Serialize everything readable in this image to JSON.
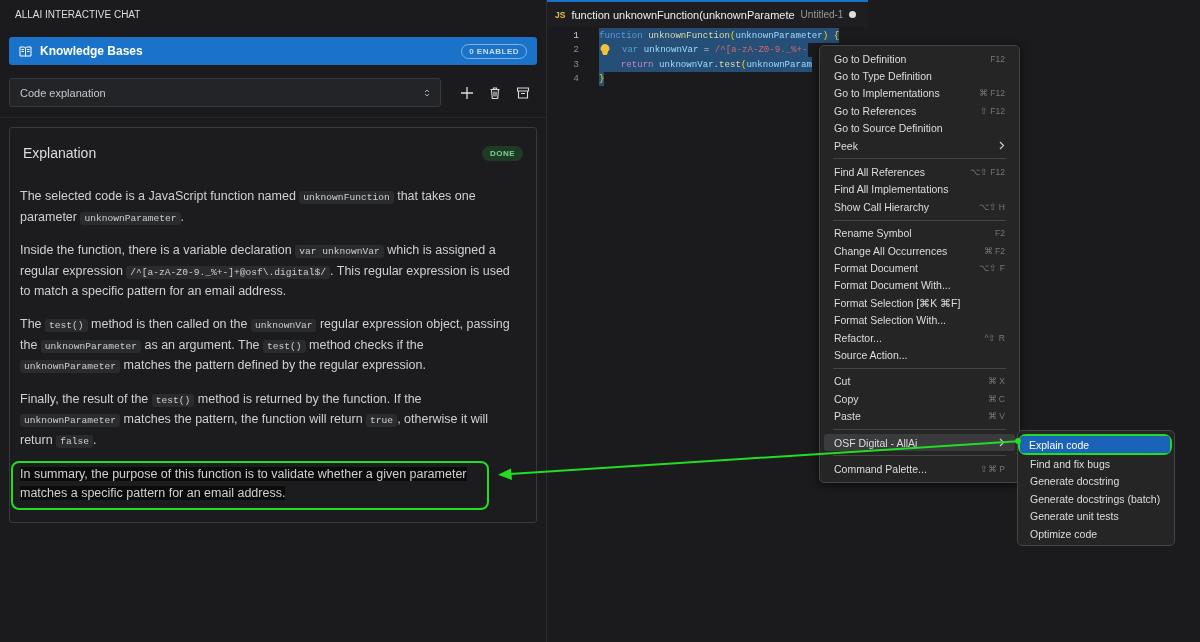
{
  "panel": {
    "title": "ALLAI INTERACTIVE CHAT",
    "knowledge_bases": {
      "label": "Knowledge Bases",
      "badge": "0 ENABLED"
    },
    "prompt_select": {
      "value": "Code explanation"
    },
    "card": {
      "title": "Explanation",
      "status": "DONE",
      "paragraphs": [
        {
          "highlighted": false,
          "parts": [
            {
              "kind": "text",
              "text": "The selected code is a JavaScript function named "
            },
            {
              "kind": "code",
              "text": "unknownFunction"
            },
            {
              "kind": "text",
              "text": " that takes one parameter "
            },
            {
              "kind": "code",
              "text": "unknownParameter"
            },
            {
              "kind": "text",
              "text": "."
            }
          ]
        },
        {
          "highlighted": false,
          "parts": [
            {
              "kind": "text",
              "text": "Inside the function, there is a variable declaration "
            },
            {
              "kind": "code",
              "text": "var unknownVar"
            },
            {
              "kind": "text",
              "text": " which is assigned a regular expression "
            },
            {
              "kind": "code",
              "text": "/^[a-zA-Z0-9._%+-]+@osf\\.digital$/"
            },
            {
              "kind": "text",
              "text": ". This regular expression is used to match a specific pattern for an email address."
            }
          ]
        },
        {
          "highlighted": false,
          "parts": [
            {
              "kind": "text",
              "text": "The "
            },
            {
              "kind": "code",
              "text": "test()"
            },
            {
              "kind": "text",
              "text": " method is then called on the "
            },
            {
              "kind": "code",
              "text": "unknownVar"
            },
            {
              "kind": "text",
              "text": " regular expression object, passing the "
            },
            {
              "kind": "code",
              "text": "unknownParameter"
            },
            {
              "kind": "text",
              "text": " as an argument. The "
            },
            {
              "kind": "code",
              "text": "test()"
            },
            {
              "kind": "text",
              "text": " method checks if the "
            },
            {
              "kind": "code",
              "text": "unknownParameter"
            },
            {
              "kind": "text",
              "text": " matches the pattern defined by the regular expression."
            }
          ]
        },
        {
          "highlighted": false,
          "parts": [
            {
              "kind": "text",
              "text": "Finally, the result of the "
            },
            {
              "kind": "code",
              "text": "test()"
            },
            {
              "kind": "text",
              "text": " method is returned by the function. If the "
            },
            {
              "kind": "code",
              "text": "unknownParameter"
            },
            {
              "kind": "text",
              "text": " matches the pattern, the function will return "
            },
            {
              "kind": "code",
              "text": "true"
            },
            {
              "kind": "text",
              "text": ", otherwise it will return "
            },
            {
              "kind": "code",
              "text": "false"
            },
            {
              "kind": "text",
              "text": "."
            }
          ]
        },
        {
          "highlighted": true,
          "parts": [
            {
              "kind": "text",
              "text": "In summary, the purpose of this function is to validate whether a given parameter matches a specific pattern for an email address."
            }
          ]
        }
      ]
    }
  },
  "editor": {
    "tab": {
      "icon": "JS",
      "title": "function unknownFunction(unknownParamete",
      "file": "Untitled-1",
      "modified": true
    },
    "lines": [
      {
        "number": "1",
        "lightbulb": false,
        "tokens": [
          {
            "kind": "keyword",
            "text": "function "
          },
          {
            "kind": "function",
            "text": "unknownFunction"
          },
          {
            "kind": "brace",
            "text": "("
          },
          {
            "kind": "param",
            "text": "unknownParameter"
          },
          {
            "kind": "brace",
            "text": ") {"
          }
        ]
      },
      {
        "number": "2",
        "lightbulb": true,
        "tokens": [
          {
            "kind": "keyword",
            "text": "var "
          },
          {
            "kind": "param",
            "text": "unknownVar"
          },
          {
            "kind": "plain",
            "text": " = "
          },
          {
            "kind": "regex",
            "text": "/^[a-zA-Z0-9._%+-"
          }
        ]
      },
      {
        "number": "3",
        "lightbulb": false,
        "tokens": [
          {
            "kind": "control",
            "text": "    return "
          },
          {
            "kind": "param",
            "text": "unknownVar"
          },
          {
            "kind": "plain",
            "text": "."
          },
          {
            "kind": "function",
            "text": "test"
          },
          {
            "kind": "brace",
            "text": "("
          },
          {
            "kind": "param",
            "text": "unknownParam"
          }
        ]
      },
      {
        "number": "4",
        "lightbulb": false,
        "tokens": [
          {
            "kind": "brace",
            "text": "}"
          }
        ]
      }
    ]
  },
  "context_menu": {
    "groups": [
      [
        {
          "label": "Go to Definition",
          "shortcut": "F12",
          "submenu": false,
          "selected": false
        },
        {
          "label": "Go to Type Definition",
          "submenu": false,
          "selected": false
        },
        {
          "label": "Go to Implementations",
          "shortcut": "⌘ F12",
          "submenu": false,
          "selected": false
        },
        {
          "label": "Go to References",
          "shortcut": "⇧ F12",
          "submenu": false,
          "selected": false
        },
        {
          "label": "Go to Source Definition",
          "submenu": false,
          "selected": false
        },
        {
          "label": "Peek",
          "submenu": true,
          "selected": false
        }
      ],
      [
        {
          "label": "Find All References",
          "shortcut": "⌥⇧ F12",
          "submenu": false,
          "selected": false
        },
        {
          "label": "Find All Implementations",
          "submenu": false,
          "selected": false
        },
        {
          "label": "Show Call Hierarchy",
          "shortcut": "⌥⇧ H",
          "submenu": false,
          "selected": false
        }
      ],
      [
        {
          "label": "Rename Symbol",
          "shortcut": "F2",
          "submenu": false,
          "selected": false
        },
        {
          "label": "Change All Occurrences",
          "shortcut": "⌘ F2",
          "submenu": false,
          "selected": false
        },
        {
          "label": "Format Document",
          "shortcut": "⌥⇧ F",
          "submenu": false,
          "selected": false
        },
        {
          "label": "Format Document With...",
          "submenu": false,
          "selected": false
        },
        {
          "label": "Format Selection [⌘K ⌘F]",
          "submenu": false,
          "selected": false
        },
        {
          "label": "Format Selection With...",
          "submenu": false,
          "selected": false
        },
        {
          "label": "Refactor...",
          "shortcut": "^⇧ R",
          "submenu": false,
          "selected": false
        },
        {
          "label": "Source Action...",
          "submenu": false,
          "selected": false
        }
      ],
      [
        {
          "label": "Cut",
          "shortcut": "⌘ X",
          "submenu": false,
          "selected": false
        },
        {
          "label": "Copy",
          "shortcut": "⌘ C",
          "submenu": false,
          "selected": false
        },
        {
          "label": "Paste",
          "shortcut": "⌘ V",
          "submenu": false,
          "selected": false
        }
      ],
      [
        {
          "label": "OSF Digital - AllAi",
          "submenu": true,
          "selected": true
        }
      ],
      [
        {
          "label": "Command Palette...",
          "shortcut": "⇧⌘ P",
          "submenu": false,
          "selected": false
        }
      ]
    ]
  },
  "submenu": {
    "items": [
      {
        "label": "Explain code",
        "selected": true
      },
      {
        "label": "Find and fix bugs",
        "selected": false
      },
      {
        "label": "Generate docstring",
        "selected": false
      },
      {
        "label": "Generate docstrings (batch)",
        "selected": false
      },
      {
        "label": "Generate unit tests",
        "selected": false
      },
      {
        "label": "Optimize code",
        "selected": false
      }
    ]
  }
}
